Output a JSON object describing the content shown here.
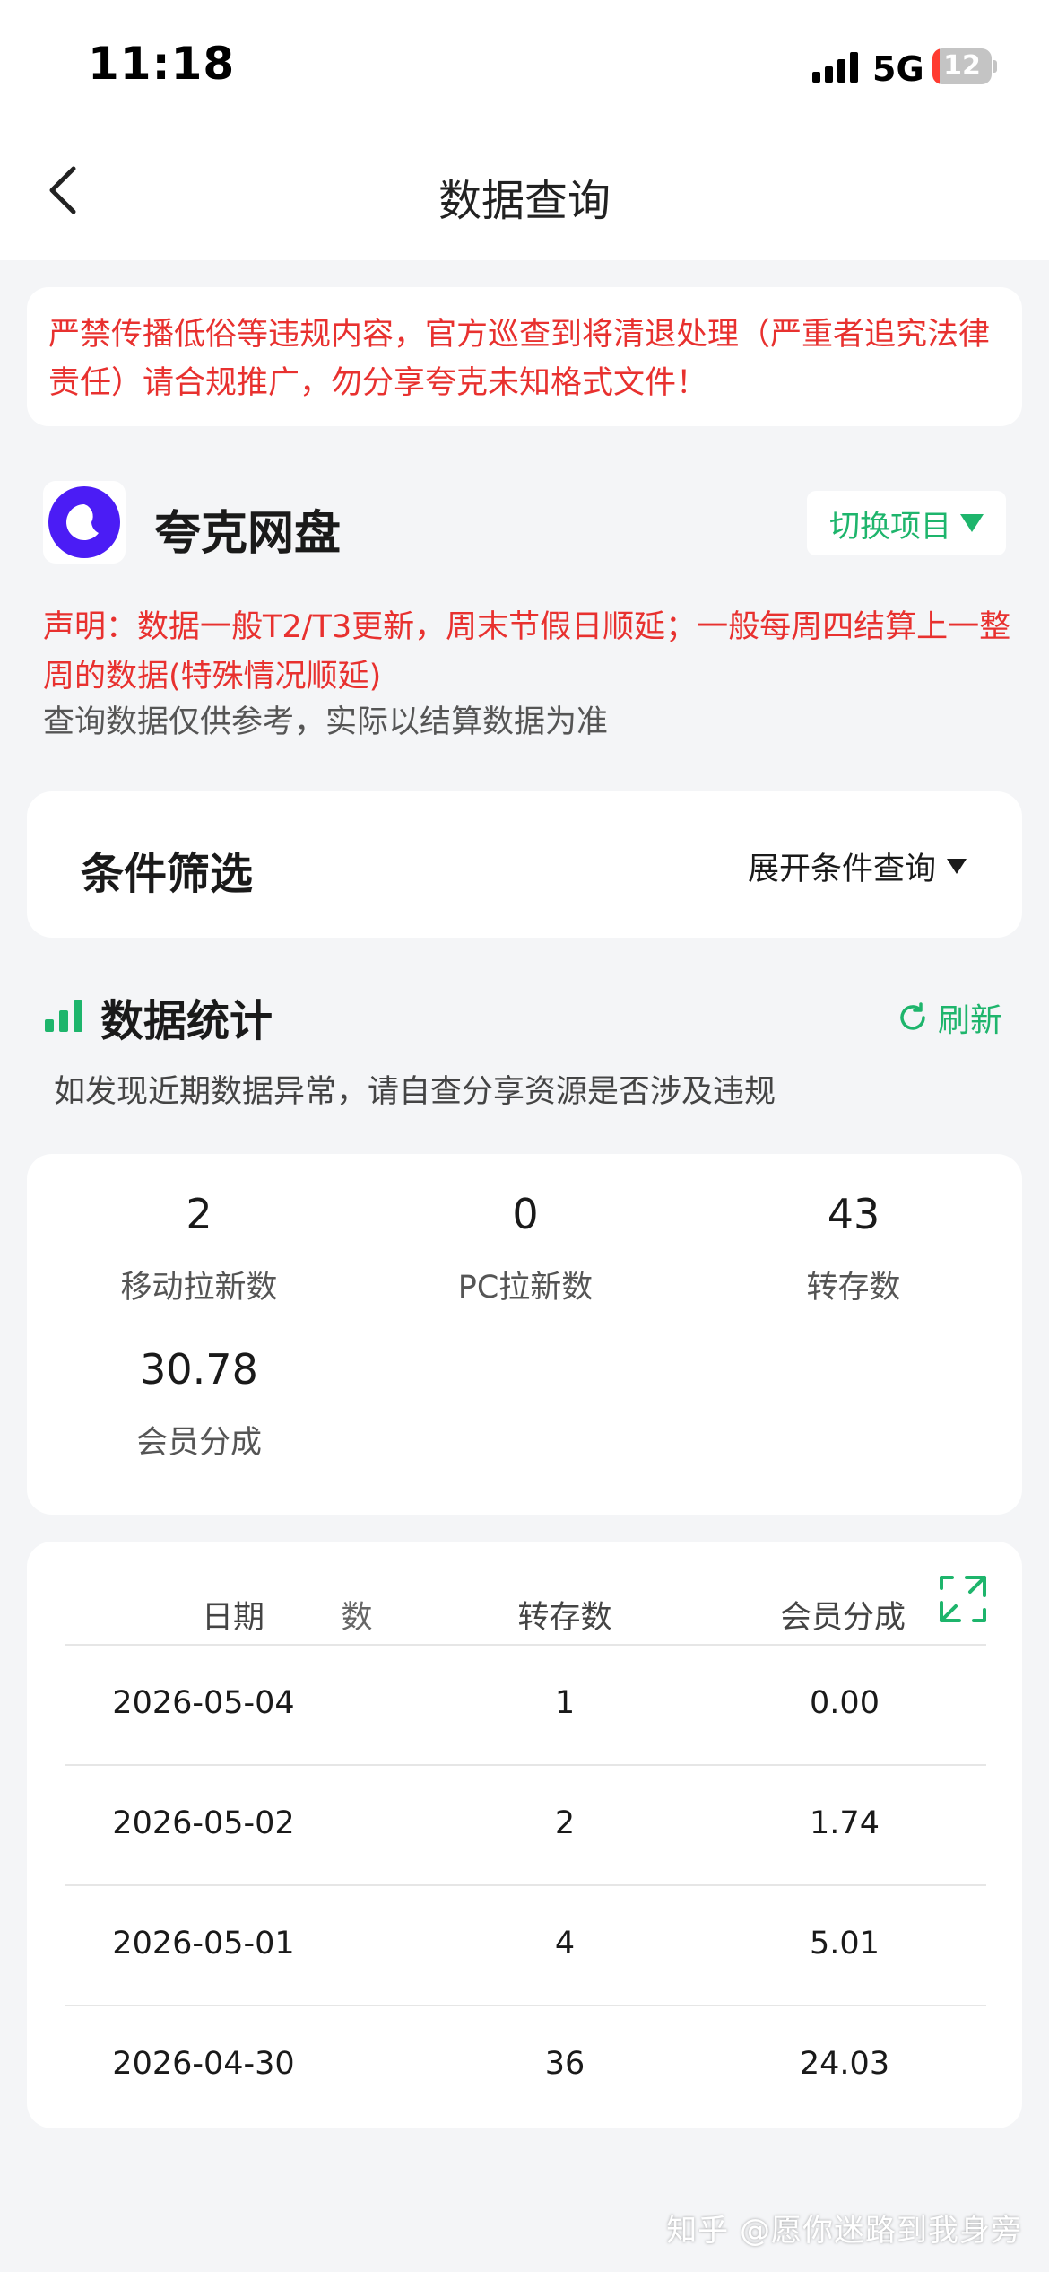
{
  "status_bar": {
    "time": "11:18",
    "network": "5G",
    "battery": "12",
    "battery_level": 0.12
  },
  "nav": {
    "title": "数据查询"
  },
  "warning": {
    "text": "严禁传播低俗等违规内容，官方巡查到将清退处理（严重者追究法律责任）请合规推广，勿分享夸克未知格式文件！"
  },
  "app": {
    "name": "夸克网盘",
    "switch_label": "切换项目"
  },
  "notice": {
    "statement": "声明：数据一般T2/T3更新，周末节假日顺延；一般每周四结算上一整周的数据(特殊情况顺延)",
    "reference": "查询数据仅供参考，实际以结算数据为准"
  },
  "filter": {
    "title": "条件筛选",
    "expand_label": "展开条件查询"
  },
  "stats": {
    "title": "数据统计",
    "refresh_label": "刷新",
    "hint": "如发现近期数据异常，请自查分享资源是否涉及违规",
    "items": [
      {
        "value": "2",
        "label": "移动拉新数"
      },
      {
        "value": "0",
        "label": "PC拉新数"
      },
      {
        "value": "43",
        "label": "转存数"
      },
      {
        "value": "30.78",
        "label": "会员分成"
      }
    ]
  },
  "table": {
    "headers": [
      "日期",
      "",
      "转存数",
      "会员分成"
    ],
    "clipped_header": "数",
    "rows": [
      {
        "date": "2026-05-04",
        "saves": "1",
        "share": "0.00"
      },
      {
        "date": "2026-05-02",
        "saves": "2",
        "share": "1.74"
      },
      {
        "date": "2026-05-01",
        "saves": "4",
        "share": "5.01"
      },
      {
        "date": "2026-04-30",
        "saves": "36",
        "share": "24.03"
      }
    ]
  },
  "watermark": "知乎 @愿你迷路到我身旁",
  "colors": {
    "accent": "#1eb56c",
    "warning": "#e8312f",
    "brand": "#4b1cf5"
  }
}
